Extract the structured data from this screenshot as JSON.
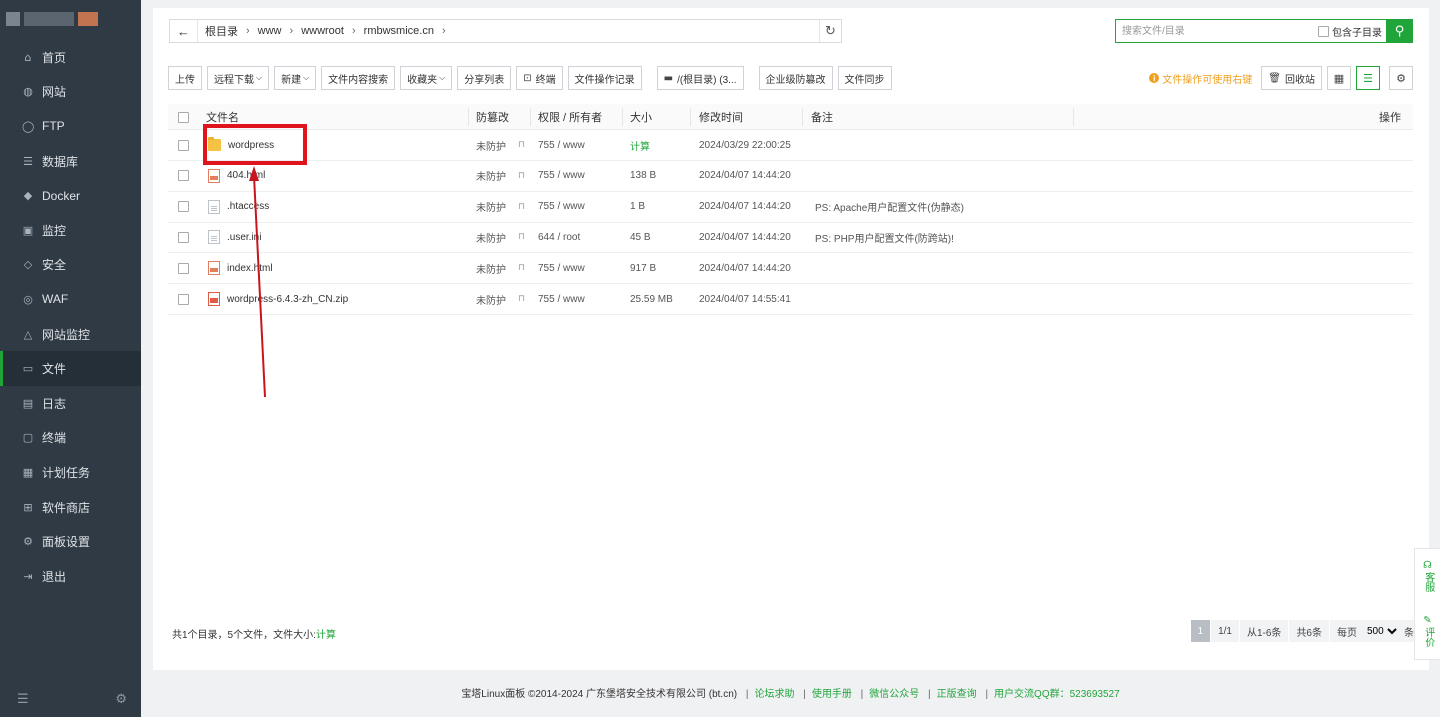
{
  "sidebar": {
    "items": [
      {
        "label": "首页",
        "icon": "⌂"
      },
      {
        "label": "网站",
        "icon": "◍"
      },
      {
        "label": "FTP",
        "icon": "◯"
      },
      {
        "label": "数据库",
        "icon": "☰"
      },
      {
        "label": "Docker",
        "icon": "◆"
      },
      {
        "label": "监控",
        "icon": "▣"
      },
      {
        "label": "安全",
        "icon": "◇"
      },
      {
        "label": "WAF",
        "icon": "◎"
      },
      {
        "label": "网站监控",
        "icon": "△"
      },
      {
        "label": "文件",
        "icon": "▭"
      },
      {
        "label": "日志",
        "icon": "▤"
      },
      {
        "label": "终端",
        "icon": "▢"
      },
      {
        "label": "计划任务",
        "icon": "▦"
      },
      {
        "label": "软件商店",
        "icon": "⊞"
      },
      {
        "label": "面板设置",
        "icon": "⚙"
      },
      {
        "label": "退出",
        "icon": "⇥"
      }
    ],
    "active_index": 9,
    "collapse_icon": "☰",
    "settings_icon": "⚙"
  },
  "path": {
    "back_icon": "←",
    "crumbs": [
      "根目录",
      "www",
      "wwwroot",
      "rmbwsmice.cn"
    ],
    "sep": "›",
    "refresh_icon": "↻"
  },
  "search": {
    "placeholder": "搜索文件/目录",
    "subdir_label": "包含子目录",
    "button_icon": "⚲"
  },
  "toolbar": {
    "upload": "上传",
    "remote_download": "远程下载",
    "new": "新建",
    "content_search": "文件内容搜索",
    "favorites": "收藏夹",
    "share_list": "分享列表",
    "terminal": "终端",
    "op_log": "文件操作记录",
    "disk": "/(根目录) (3...",
    "tamper": "企业级防篡改",
    "sync": "文件同步"
  },
  "right_tools": {
    "tip": "文件操作可使用右键",
    "recycle": "回收站"
  },
  "columns": {
    "name": "文件名",
    "tamper": "防篡改",
    "perm": "权限 / 所有者",
    "size": "大小",
    "mtime": "修改时间",
    "note": "备注",
    "ops": "操作"
  },
  "files": [
    {
      "name": "wordpress",
      "type": "folder",
      "tamper": "未防护",
      "perm": "755 / www",
      "size": "计算",
      "mtime": "2024/03/29 22:00:25",
      "note": ""
    },
    {
      "name": "404.html",
      "type": "html",
      "tamper": "未防护",
      "perm": "755 / www",
      "size": "138 B",
      "mtime": "2024/04/07 14:44:20",
      "note": ""
    },
    {
      "name": ".htaccess",
      "type": "txt",
      "tamper": "未防护",
      "perm": "755 / www",
      "size": "1 B",
      "mtime": "2024/04/07 14:44:20",
      "note": "PS: Apache用户配置文件(伪静态)"
    },
    {
      "name": ".user.ini",
      "type": "txt",
      "tamper": "未防护",
      "perm": "644 / root",
      "size": "45 B",
      "mtime": "2024/04/07 14:44:20",
      "note": "PS: PHP用户配置文件(防跨站)!"
    },
    {
      "name": "index.html",
      "type": "html",
      "tamper": "未防护",
      "perm": "755 / www",
      "size": "917 B",
      "mtime": "2024/04/07 14:44:20",
      "note": ""
    },
    {
      "name": "wordpress-6.4.3-zh_CN.zip",
      "type": "zip",
      "tamper": "未防护",
      "perm": "755 / www",
      "size": "25.59 MB",
      "mtime": "2024/04/07 14:55:41",
      "note": ""
    }
  ],
  "summary": {
    "text": "共1个目录，5个文件，文件大小:",
    "calc": "计算"
  },
  "pager": {
    "current": "1",
    "pages": "1/1",
    "range": "从1-6条",
    "total": "共6条",
    "per_page_label": "每页",
    "per_page": "500",
    "unit": "条"
  },
  "float": {
    "service": "客服",
    "rate": "评价"
  },
  "footer": {
    "copyright": "宝塔Linux面板 ©2014-2024 广东堡塔安全技术有限公司 (bt.cn)",
    "links": [
      "论坛求助",
      "使用手册",
      "微信公众号",
      "正版查询",
      "用户交流QQ群：523693527"
    ]
  },
  "colors": {
    "accent": "#20a53a",
    "sidebar": "#2f3a44",
    "highlight": "#e0141d"
  }
}
